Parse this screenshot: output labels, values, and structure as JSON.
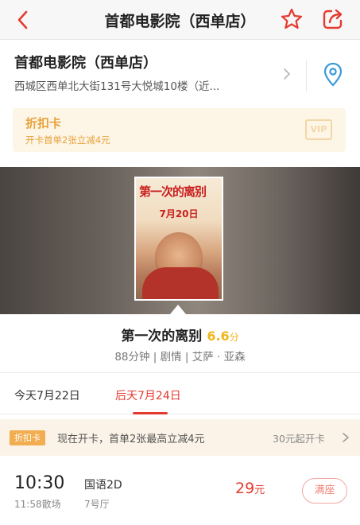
{
  "header": {
    "title": "首都电影院（西单店）",
    "back_icon": "chevron-left-icon",
    "favorite_icon": "star-outline-icon",
    "share_icon": "share-icon",
    "accent_color": "#e53a2f"
  },
  "cinema": {
    "name": "首都电影院（西单店）",
    "address": "西城区西单北大街131号大悦城10楼（近...",
    "location_icon": "map-pin-icon"
  },
  "discount_card": {
    "label": "折扣卡",
    "description": "开卡首单2张立减4元",
    "badge": "VIP",
    "color": "#e8a33c"
  },
  "movie": {
    "poster_title": "第一次的离别",
    "poster_date": "7月20日",
    "title": "第一次的离别",
    "score": "6.6",
    "score_unit": "分",
    "meta": "88分钟 | 剧情 | 艾萨 · 亚森"
  },
  "date_tabs": [
    {
      "label": "今天7月22日",
      "selected": false
    },
    {
      "label": "后天7月24日",
      "selected": true
    }
  ],
  "promo": {
    "tag": "折扣卡",
    "text": "现在开卡，首单2张最高立减4元",
    "right_text": "30元起开卡"
  },
  "showtimes": [
    {
      "start": "10:30",
      "end": "11:58散场",
      "language": "国语2D",
      "hall": "7号厅",
      "price": "29",
      "price_unit": "元",
      "status": "满座"
    }
  ]
}
